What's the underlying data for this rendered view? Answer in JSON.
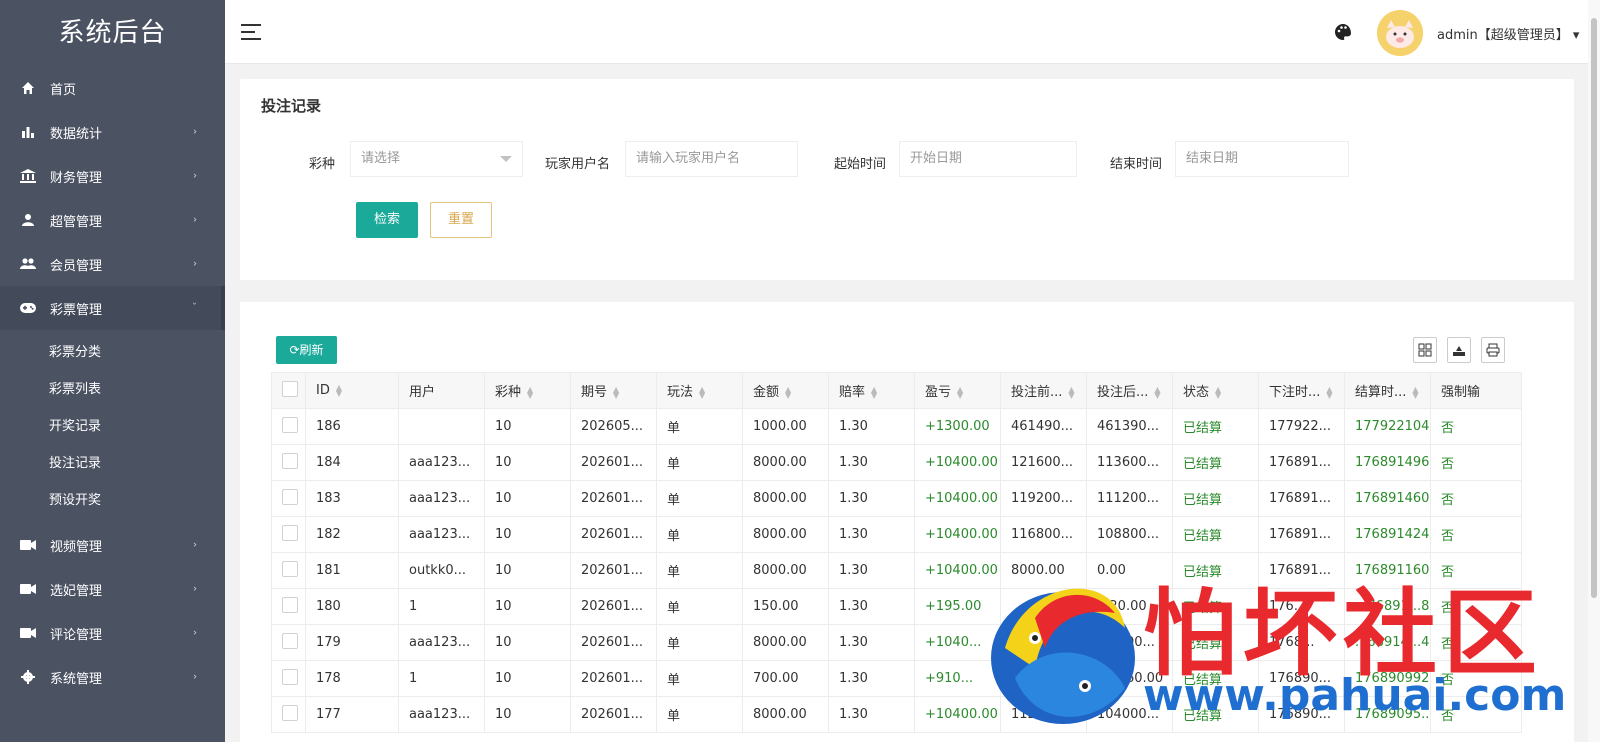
{
  "brand": "系统后台",
  "sidebar": {
    "items": [
      {
        "label": "首页",
        "icon": "home-icon",
        "arrow": false
      },
      {
        "label": "数据统计",
        "icon": "bar-chart-icon",
        "arrow": true
      },
      {
        "label": "财务管理",
        "icon": "bank-icon",
        "arrow": true
      },
      {
        "label": "超管管理",
        "icon": "user-icon",
        "arrow": true
      },
      {
        "label": "会员管理",
        "icon": "users-icon",
        "arrow": true
      }
    ],
    "open": {
      "label": "彩票管理",
      "icon": "gamepad-icon"
    },
    "sub": [
      "彩票分类",
      "彩票列表",
      "开奖记录",
      "投注记录",
      "预设开奖"
    ],
    "rest": [
      {
        "label": "视频管理",
        "icon": "video-icon"
      },
      {
        "label": "选妃管理",
        "icon": "video-icon"
      },
      {
        "label": "评论管理",
        "icon": "video-icon"
      },
      {
        "label": "系统管理",
        "icon": "gear-icon"
      }
    ],
    "arrow_glyph": "›",
    "arrow_down_glyph": "ˇ"
  },
  "header": {
    "user": "admin【超级管理员】",
    "caret": "▾"
  },
  "search": {
    "title": "投注记录",
    "lottery_label": "彩种",
    "lottery_placeholder": "请选择",
    "player_label": "玩家用户名",
    "player_placeholder": "请输入玩家用户名",
    "start_label": "起始时间",
    "start_placeholder": "开始日期",
    "end_label": "结束时间",
    "end_placeholder": "结束日期",
    "search_btn": "检索",
    "reset_btn": "重置"
  },
  "table": {
    "refresh": "刷新",
    "headers": [
      "ID",
      "用户",
      "彩种",
      "期号",
      "玩法",
      "金额",
      "赔率",
      "盈亏",
      "投注前...",
      "投注后...",
      "状态",
      "下注时...",
      "结算时...",
      "强制输"
    ],
    "rows": [
      [
        "186",
        "",
        "10",
        "202605...",
        "单",
        "1000.00",
        "1.30",
        "+1300.00",
        "461490...",
        "461390...",
        "已结算",
        "177922...",
        "1779221041",
        "否"
      ],
      [
        "184",
        "aaa123...",
        "10",
        "202601...",
        "单",
        "8000.00",
        "1.30",
        "+10400.00",
        "121600...",
        "113600...",
        "已结算",
        "176891...",
        "1768914961",
        "否"
      ],
      [
        "183",
        "aaa123...",
        "10",
        "202601...",
        "单",
        "8000.00",
        "1.30",
        "+10400.00",
        "119200...",
        "111200...",
        "已结算",
        "176891...",
        "1768914601",
        "否"
      ],
      [
        "182",
        "aaa123...",
        "10",
        "202601...",
        "单",
        "8000.00",
        "1.30",
        "+10400.00",
        "116800...",
        "108800...",
        "已结算",
        "176891...",
        "1768914241",
        "否"
      ],
      [
        "181",
        "outkk0...",
        "10",
        "202601...",
        "单",
        "8000.00",
        "1.30",
        "+10400.00",
        "8000.00",
        "0.00",
        "已结算",
        "176891...",
        "1768911601",
        "否"
      ],
      [
        "180",
        "1",
        "10",
        "202601...",
        "单",
        "150.00",
        "1.30",
        "+195.00",
        "",
        "...20.00",
        "已结算",
        "176...",
        "...76891...88",
        "否"
      ],
      [
        "179",
        "aaa123...",
        "10",
        "202601...",
        "单",
        "8000.00",
        "1.30",
        "+1040...",
        "...40...",
        "...6400...",
        "已结算",
        "1768...",
        "...68914...41",
        "否"
      ],
      [
        "178",
        "1",
        "10",
        "202601...",
        "单",
        "700.00",
        "1.30",
        "+910...",
        "",
        "...4160.00",
        "已结算",
        "176890...",
        "176890992...",
        "否"
      ],
      [
        "177",
        "aaa123...",
        "10",
        "202601...",
        "单",
        "8000.00",
        "1.30",
        "+10400.00",
        "112000...",
        "104000...",
        "已结算",
        "176890...",
        "17689095...",
        "否"
      ]
    ]
  },
  "watermark": {
    "title": "怕坏社区",
    "url": "www.pahuai.com"
  }
}
